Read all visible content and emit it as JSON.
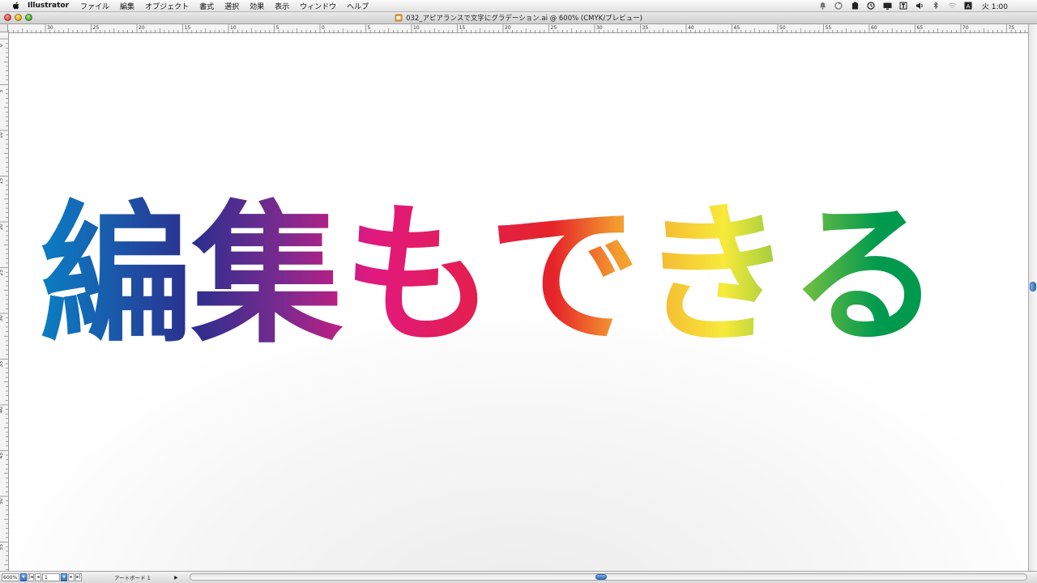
{
  "menubar": {
    "app_name": "Illustrator",
    "items": [
      "ファイル",
      "編集",
      "オブジェクト",
      "書式",
      "選択",
      "効果",
      "表示",
      "ウィンドウ",
      "ヘルプ"
    ],
    "clock": "火 1:00",
    "status_icons": [
      "bell-icon",
      "sync-icon",
      "clipboard-icon",
      "time-machine-icon",
      "display-icon",
      "script-icon",
      "volume-icon",
      "bluetooth-icon",
      "wifi-icon",
      "input-method-icon"
    ]
  },
  "window": {
    "title": "032_アピアランスで文字にグラデーション.ai @ 600% (CMYK/プレビュー)"
  },
  "rulers": {
    "horizontal_labels": [
      "30",
      "25",
      "20",
      "15",
      "10",
      "5",
      "0",
      "5",
      "10",
      "15",
      "20",
      "25",
      "30",
      "35",
      "40",
      "45",
      "50",
      "55",
      "60",
      "65",
      "70",
      "75"
    ],
    "vertical_labels": [
      "0",
      "5",
      "10",
      "15",
      "20",
      "25",
      "30",
      "35",
      "40",
      "45",
      "50",
      "55"
    ]
  },
  "artwork": {
    "text": "編集もできる",
    "gradient_colors": [
      "#0a7fc4",
      "#2b2f8e",
      "#7b2a8e",
      "#e1197f",
      "#e5232a",
      "#f39a2e",
      "#f7ea3a",
      "#8cc63f",
      "#009a4e"
    ]
  },
  "statusbar": {
    "zoom": "600%",
    "page": "1",
    "artboard_label": "アートボード 1"
  }
}
